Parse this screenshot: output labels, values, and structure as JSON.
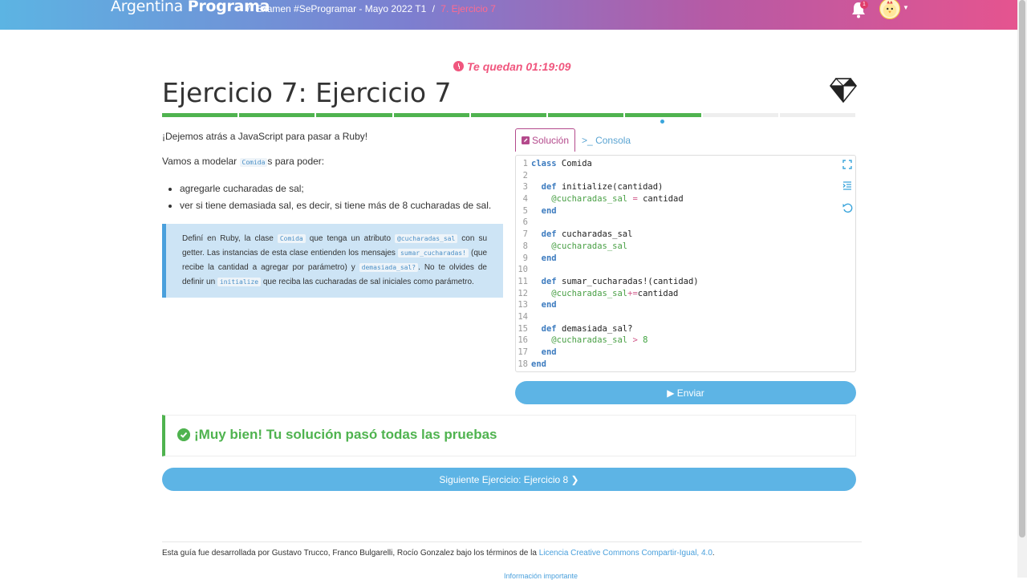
{
  "header": {
    "brand_light": "Argentina",
    "brand_bold": "Programa",
    "sep": "/",
    "crumb_exam": "Examen #SeProgramar - Mayo 2022 T1",
    "crumb_current": "7. Ejercicio 7",
    "notifications_count": "1"
  },
  "timer": "Te quedan 01:19:09",
  "title": "Ejercicio 7: Ejercicio 7",
  "progress": {
    "total": 9,
    "done": 7,
    "current": 7
  },
  "description": {
    "intro": "¡Dejemos atrás a JavaScript para pasar a Ruby!",
    "model_pre": "Vamos a modelar ",
    "model_code": "Comida",
    "model_post": "s para poder:",
    "bullets": [
      "agregarle cucharadas de sal;",
      "ver si tiene demasiada sal, es decir, si tiene más de 8 cucharadas de sal."
    ],
    "tip": {
      "p1": "Definí en Ruby, la clase ",
      "c1": "Comida",
      "p2": " que tenga un atributo ",
      "c2": "@cucharadas_sal",
      "p3": " con su getter. Las instancias de esta clase entienden los mensajes ",
      "c3": "sumar_cucharadas!",
      "p4": " (que recibe la cantidad a agregar por parámetro) y ",
      "c4": "demasiada_sal?",
      "p5": ". No te olvides de definir un ",
      "c5": "initialize",
      "p6": " que reciba las cucharadas de sal iniciales como parámetro."
    }
  },
  "editor": {
    "tab_solution": "Solución",
    "tab_console": "Consola",
    "lines": [
      "1",
      "2",
      "3",
      "4",
      "5",
      "6",
      "7",
      "8",
      "9",
      "10",
      "11",
      "12",
      "13",
      "14",
      "15",
      "16",
      "17",
      "18"
    ]
  },
  "send_label": "Enviar",
  "success_message": "¡Muy bien! Tu solución pasó todas las pruebas",
  "next_label": "Siguiente Ejercicio: Ejercicio 8",
  "footer": {
    "text": "Esta guía fue desarrollada por Gustavo Trucco, Franco Bulgarelli, Rocío Gonzalez bajo los términos de la ",
    "license": "Licencia Creative Commons Compartir-Igual, 4.0",
    "end": ".",
    "info": "Información importante"
  },
  "colors": {
    "accent_pink": "#f0567e",
    "success_green": "#4fb34f",
    "button_blue": "#5db4e5",
    "ruby_purple": "#b44a8c"
  }
}
